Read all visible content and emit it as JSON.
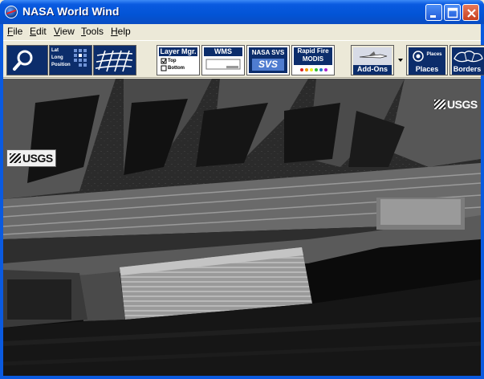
{
  "window": {
    "title": "NASA World Wind"
  },
  "menu": {
    "file": {
      "first": "F",
      "rest": "ile"
    },
    "edit": {
      "first": "E",
      "rest": "dit"
    },
    "view": {
      "first": "V",
      "rest": "iew"
    },
    "tools": {
      "first": "T",
      "rest": "ools"
    },
    "help": {
      "first": "H",
      "rest": "elp"
    }
  },
  "toolbar": {
    "latlong": {
      "lat": "Lat",
      "long": "Long",
      "position": "Position"
    },
    "layer_manager": {
      "title": "Layer Mgr.",
      "top": "Top",
      "bottom": "Bottom"
    },
    "wms": {
      "title": "WMS"
    },
    "nasa_svs": {
      "title": "NASA SVS",
      "logo": "SVS"
    },
    "rapid_fire": {
      "title1": "Rapid Fire",
      "title2": "MODIS"
    },
    "addons": {
      "label": "Add-Ons"
    },
    "places": {
      "label": "Places",
      "inner": "Places"
    },
    "borders": {
      "label": "Borders"
    }
  },
  "map": {
    "watermark_left": "USGS",
    "watermark_right": "USGS"
  },
  "colors": {
    "title_bar": "#0a5ae0",
    "toolbar_dark": "#0c2d6b",
    "window_face": "#ece9d8"
  }
}
